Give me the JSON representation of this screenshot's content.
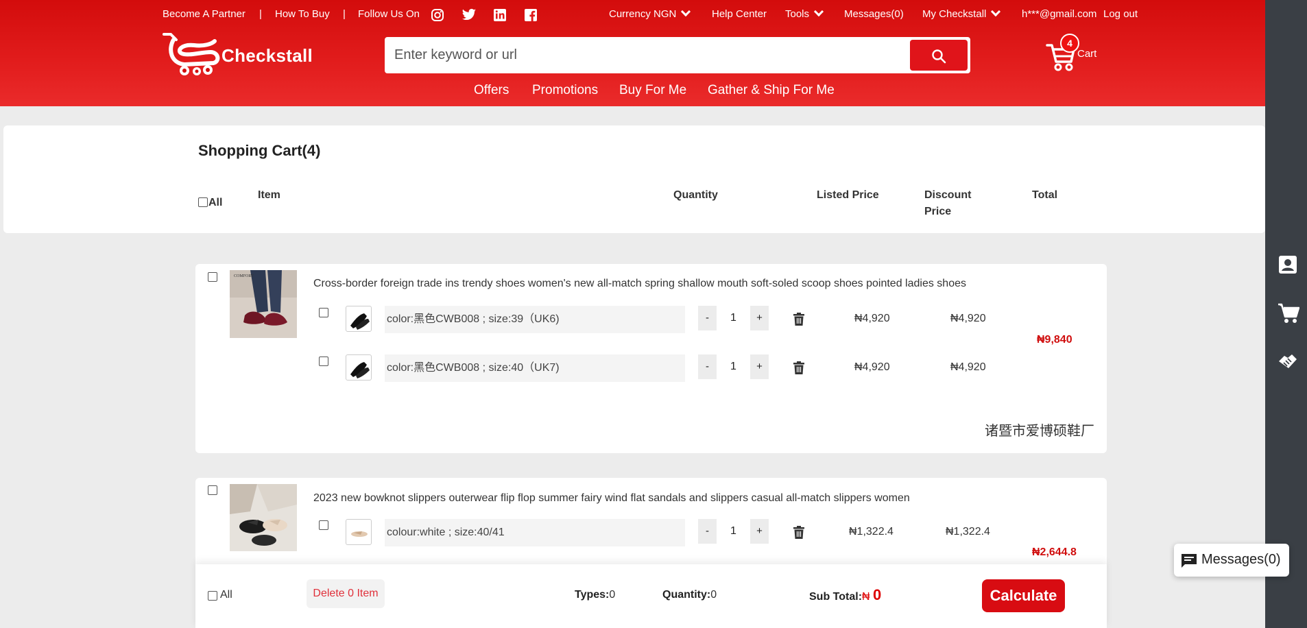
{
  "colors": {
    "brand_red": "#e0141a",
    "header_red": "#d30c0c",
    "price_red": "#d00d0d",
    "sidebar": "#3a3f45"
  },
  "topbar": {
    "become_partner": "Become A Partner",
    "sep": "|",
    "how_to_buy": "How To Buy",
    "follow_us": "Follow Us On",
    "social_icons": [
      "instagram-icon",
      "twitter-icon",
      "linkedin-icon",
      "facebook-icon"
    ],
    "currency": "Currency NGN",
    "help_center": "Help Center",
    "tools": "Tools",
    "messages": "Messages(0)",
    "my_checkstall": "My Checkstall",
    "user_email": "h***@gmail.com",
    "logout": "Log out"
  },
  "logo": {
    "text": "Checkstall"
  },
  "search": {
    "placeholder": "Enter keyword or url"
  },
  "cart_widget": {
    "count": "4",
    "label": "Cart"
  },
  "nav": [
    "Offers",
    "Promotions",
    "Buy For Me",
    "Gather & Ship For Me"
  ],
  "cart": {
    "title": "Shopping Cart(4)",
    "columns": {
      "all": "All",
      "item": "Item",
      "quantity": "Quantity",
      "listed_price": "Listed Price",
      "discount_price_1": "Discount",
      "discount_price_2": "Price",
      "total": "Total"
    }
  },
  "items": [
    {
      "title": "Cross-border foreign trade ins trendy shoes women's new all-match spring shallow mouth soft-soled scoop shoes pointed ladies shoes",
      "total": "₦9,840",
      "shop": "诸暨市爱博硕鞋厂",
      "variants": [
        {
          "desc": "color:黑色CWB008 ; size:39（UK6)",
          "qty": "1",
          "listed": "₦4,920",
          "discount": "₦4,920"
        },
        {
          "desc": "color:黑色CWB008 ; size:40（UK7)",
          "qty": "1",
          "listed": "₦4,920",
          "discount": "₦4,920"
        }
      ]
    },
    {
      "title": "2023 new bowknot slippers outerwear flip flop summer fairy wind flat sandals and slippers casual all-match slippers women",
      "total": "₦2,644.8",
      "variants": [
        {
          "desc": "colour:white ; size:40/41",
          "qty": "1",
          "listed": "₦1,322.4",
          "discount": "₦1,322.4"
        }
      ]
    }
  ],
  "qty_controls": {
    "minus": "-",
    "plus": "+"
  },
  "bottom": {
    "all": "All",
    "delete": "Delete 0 Item",
    "types_label": "Types:",
    "types_val": "0",
    "quantity_label": "Quantity:",
    "quantity_val": "0",
    "subtotal_label": "Sub Total:",
    "subtotal_cur": "₦",
    "subtotal_val": "0",
    "calculate": "Calculate"
  },
  "messages_float": "Messages(0)"
}
